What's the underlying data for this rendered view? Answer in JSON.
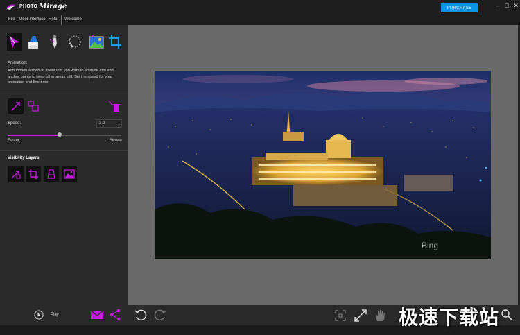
{
  "app": {
    "logo_small": "PHOTO",
    "logo_large": "Mirage",
    "purchase_label": "PURCHASE",
    "controls": {
      "minimize": "–",
      "maximize": "□",
      "close": "✕"
    }
  },
  "menu": {
    "items": [
      "File",
      "User Interface",
      "Help",
      "Welcome"
    ]
  },
  "left_panel": {
    "tools": [
      "animation-arrow-icon",
      "eraser-icon",
      "selection-pen-icon",
      "lasso-icon",
      "overlay-image-icon",
      "crop-icon"
    ],
    "animation_title": "Animation:",
    "animation_desc": "Add motion arrows to areas that you want to animate and add anchor points to keep other areas still. Set the speed for your animation and fine-tune.",
    "speed_label": "Speed:",
    "speed_value": "3.0",
    "speed_fraction": 0.46,
    "faster_label": "Faster",
    "slower_label": "Slower",
    "visibility_title": "Visibility Layers",
    "accent": "#c51de0"
  },
  "canvas": {
    "photo_label": "Bing"
  },
  "bottom": {
    "play_label": "Play"
  },
  "watermark": "极速下载站"
}
